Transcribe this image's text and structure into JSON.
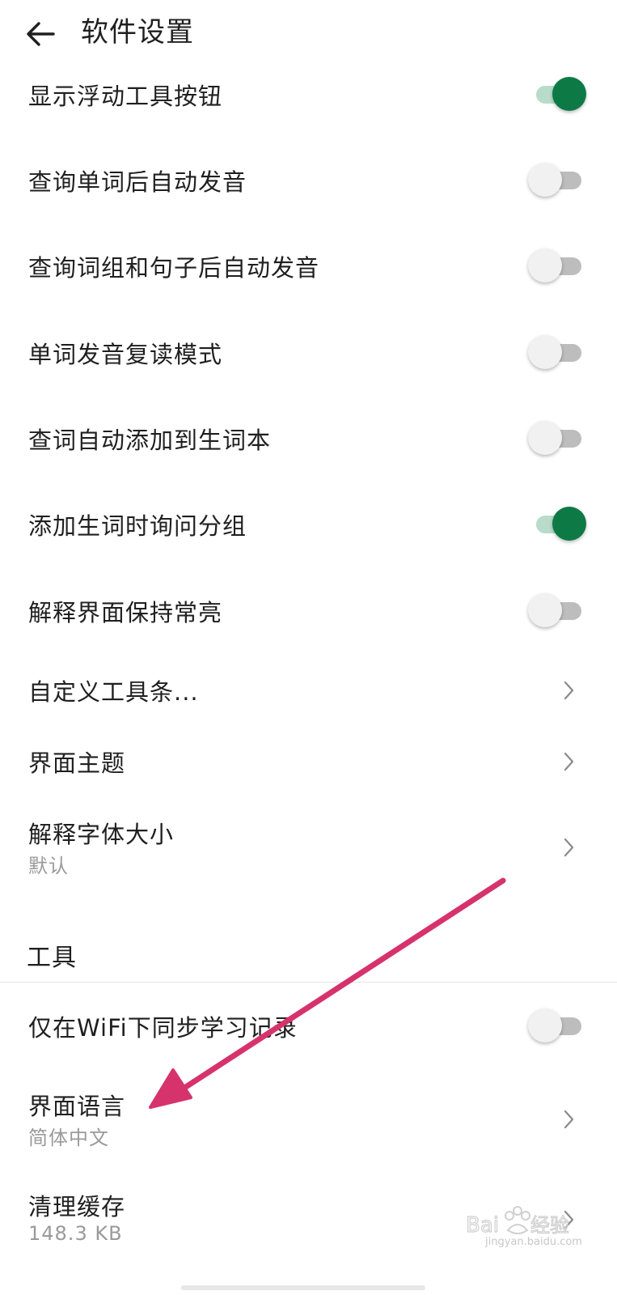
{
  "header": {
    "title": "软件设置"
  },
  "settings": [
    {
      "label": "显示浮动工具按钮",
      "toggle": true
    },
    {
      "label": "查询单词后自动发音",
      "toggle": false
    },
    {
      "label": "查询词组和句子后自动发音",
      "toggle": false
    },
    {
      "label": "单词发音复读模式",
      "toggle": false
    },
    {
      "label": "查词自动添加到生词本",
      "toggle": false
    },
    {
      "label": "添加生词时询问分组",
      "toggle": true
    },
    {
      "label": "解释界面保持常亮",
      "toggle": false
    },
    {
      "label": "自定义工具条...",
      "icon": "chevron-right-icon"
    },
    {
      "label": "界面主题",
      "icon": "chevron-right-icon"
    },
    {
      "label": "解释字体大小",
      "value": "默认",
      "icon": "chevron-right-icon"
    }
  ],
  "tools_section": {
    "title": "工具",
    "items": [
      {
        "label": "仅在WiFi下同步学习记录",
        "toggle": false
      },
      {
        "label": "界面语言",
        "value": "简体中文",
        "icon": "chevron-right-icon"
      },
      {
        "label": "清理缓存",
        "value": "148.3 KB",
        "icon": "chevron-right-icon"
      }
    ]
  },
  "watermark": {
    "logo_text": "Bai度经验",
    "url_text": "jingyan.baidu.com"
  },
  "colors": {
    "toggle_on_thumb": "#0d7a45",
    "toggle_on_track": "#b8dcc9",
    "toggle_off_thumb": "#f1f1f1",
    "toggle_off_track": "#bdbdbd",
    "annotation_arrow": "#d6336c"
  }
}
